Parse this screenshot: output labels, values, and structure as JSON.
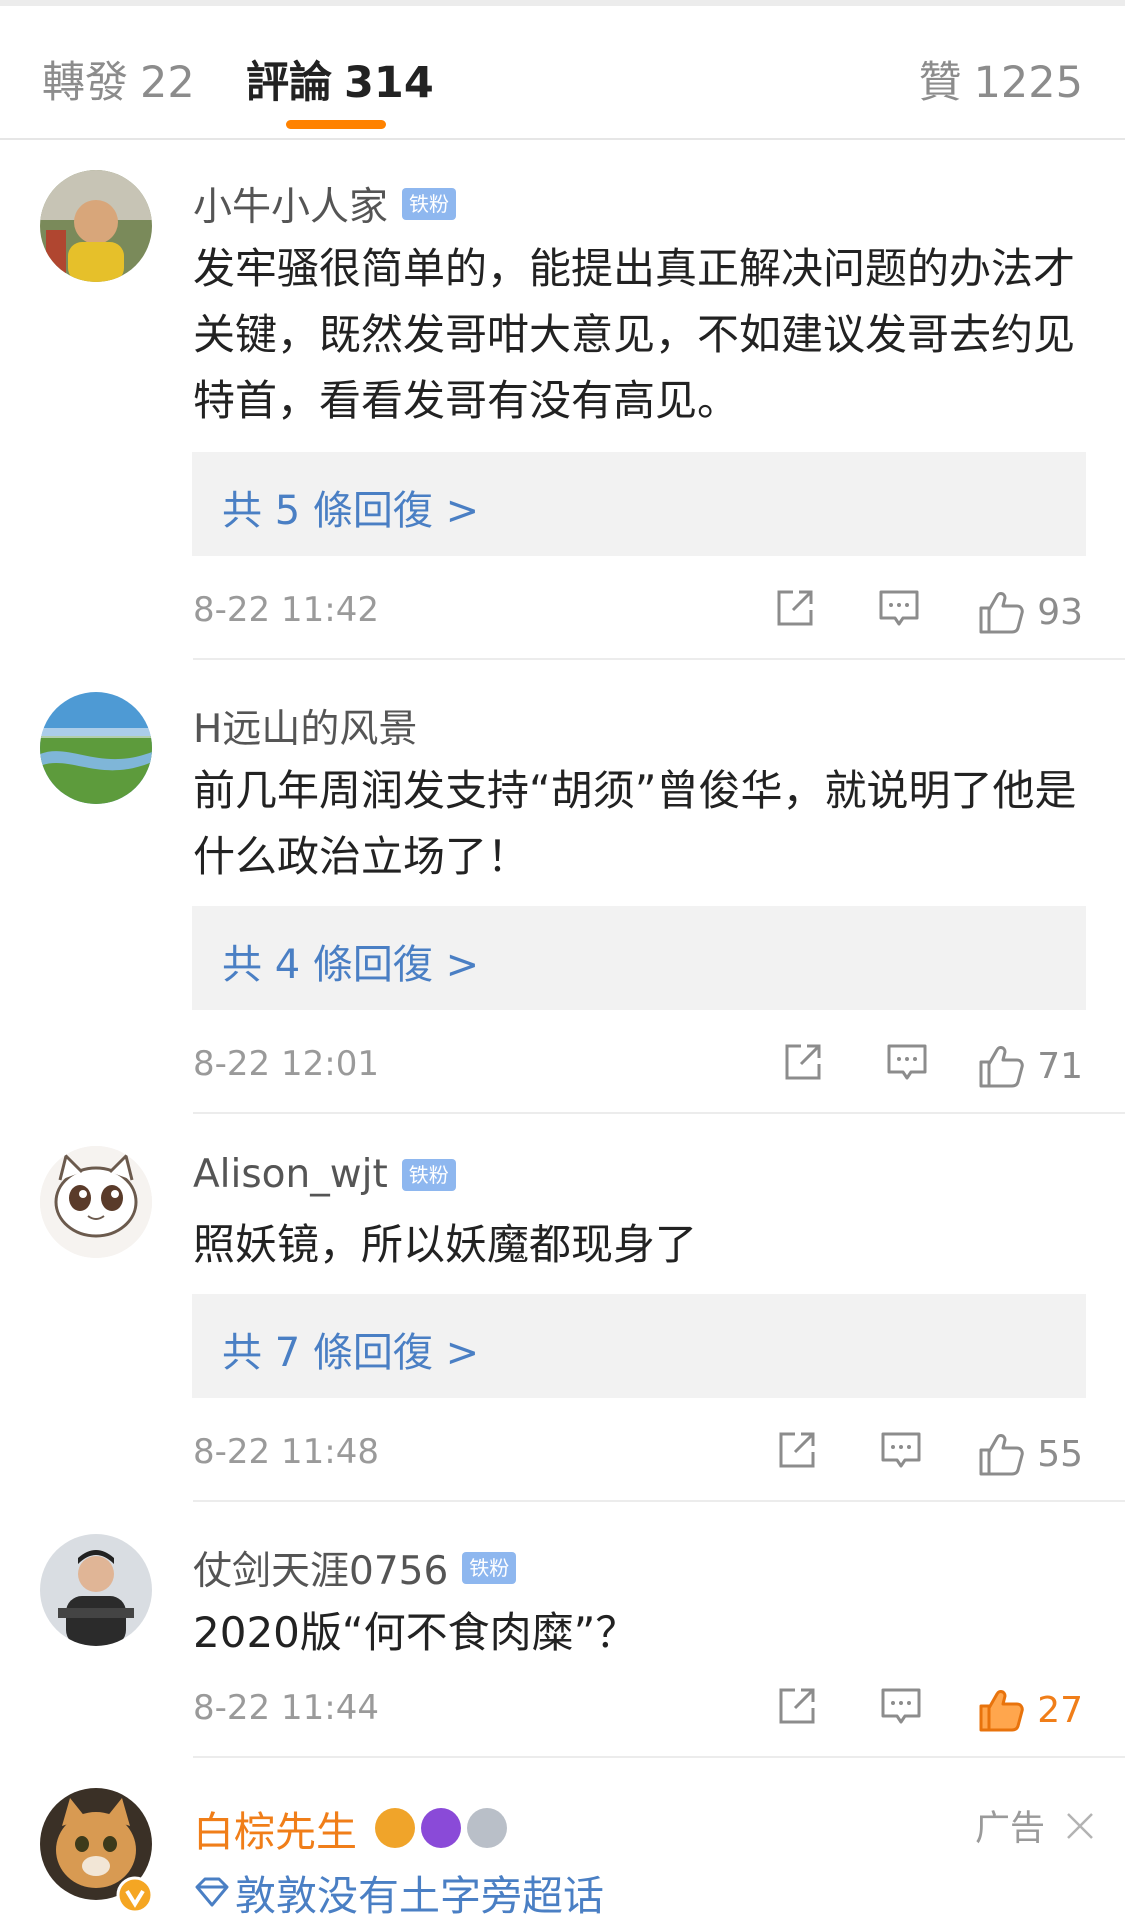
{
  "tabs": {
    "repost": {
      "label": "轉發",
      "count": "22"
    },
    "comments": {
      "label": "評論",
      "count": "314"
    },
    "likes": {
      "label": "贊",
      "count": "1225"
    }
  },
  "comments": [
    {
      "user": "小牛小人家",
      "badge": "铁粉",
      "text": "发牢骚很简单的，能提出真正解决问题的办法才关键，既然发哥咁大意见，不如建议发哥去约见特首，看看发哥有没有高见。",
      "replies": "共 5 條回復 >",
      "time": "8-22 11:42",
      "likes": "93"
    },
    {
      "user": "H远山的风景",
      "text": "前几年周润发支持“胡须”曾俊华，就说明了他是什么政治立场了！",
      "replies": "共 4 條回復 >",
      "time": "8-22 12:01",
      "likes": "71"
    },
    {
      "user": "Alison_wjt",
      "badge": "铁粉",
      "text": "照妖镜，所以妖魔都现身了",
      "replies": "共 7 條回復 >",
      "time": "8-22 11:48",
      "likes": "55"
    },
    {
      "user": "仗剑天涯0756",
      "badge": "铁粉",
      "text": "2020版“何不食肉糜”？",
      "time": "8-22 11:44",
      "likes": "27"
    }
  ],
  "ad": {
    "user": "白棕先生",
    "label": "广告",
    "topic": "敦敦没有土字旁超话"
  },
  "colors": {
    "accent": "#ff8200",
    "link": "#4a7fc4",
    "badge": "#8eb7ef",
    "liked": "#f07e19"
  }
}
